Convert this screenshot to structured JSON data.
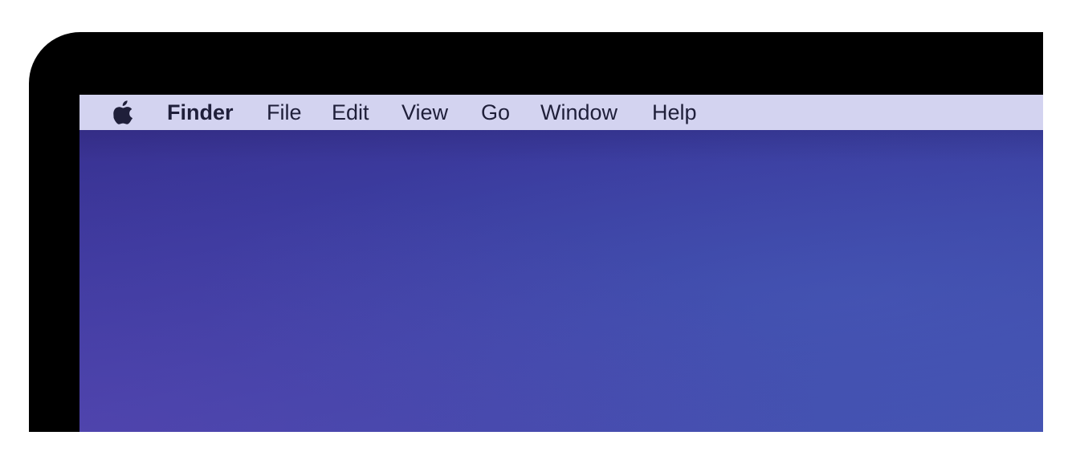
{
  "device": {
    "bezel_color": "#000000",
    "menubar_color": "#d3d3f0",
    "menu_text_color": "#1f1f3a",
    "wallpaper_colors": [
      "#3a2f8f",
      "#3e47a8",
      "#4553b2"
    ]
  },
  "menubar": {
    "apple_icon": "apple-logo-icon",
    "app_name": "Finder",
    "items": [
      {
        "label": "File"
      },
      {
        "label": "Edit"
      },
      {
        "label": "View"
      },
      {
        "label": "Go"
      },
      {
        "label": "Window"
      },
      {
        "label": "Help"
      }
    ]
  }
}
